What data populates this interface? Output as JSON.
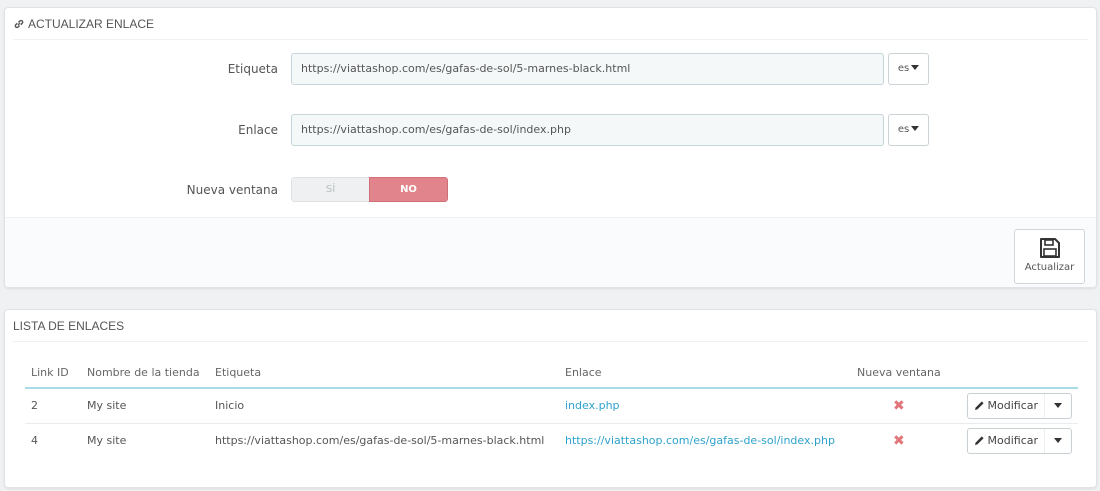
{
  "colors": {
    "accent_link": "#2ea2cc",
    "switch_no_bg": "#e2848b",
    "delete_cross": "#e1757a",
    "table_header_border": "#a8dbe6"
  },
  "update_panel": {
    "title": "ACTUALIZAR ENLACE",
    "title_icon": "link-icon",
    "label_field": {
      "label": "Etiqueta",
      "value": "https://viattashop.com/es/gafas-de-sol/5-marnes-black.html",
      "lang": "es"
    },
    "link_field": {
      "label": "Enlace",
      "value": "https://viattashop.com/es/gafas-de-sol/index.php",
      "lang": "es"
    },
    "new_window": {
      "label": "Nueva ventana",
      "yes": "SÍ",
      "no": "NO",
      "selected": "NO"
    },
    "save_button": {
      "label": "Actualizar",
      "icon": "save-icon"
    }
  },
  "list_panel": {
    "title": "LISTA DE ENLACES",
    "columns": [
      "Link ID",
      "Nombre de la tienda",
      "Etiqueta",
      "Enlace",
      "Nueva ventana"
    ],
    "rows": [
      {
        "id": "2",
        "shop": "My site",
        "label": "Inicio",
        "link": "index.php",
        "new_window": "no",
        "action": "Modificar"
      },
      {
        "id": "4",
        "shop": "My site",
        "label": "https://viattashop.com/es/gafas-de-sol/5-marnes-black.html",
        "link": "https://viattashop.com/es/gafas-de-sol/index.php",
        "new_window": "no",
        "action": "Modificar"
      }
    ]
  }
}
